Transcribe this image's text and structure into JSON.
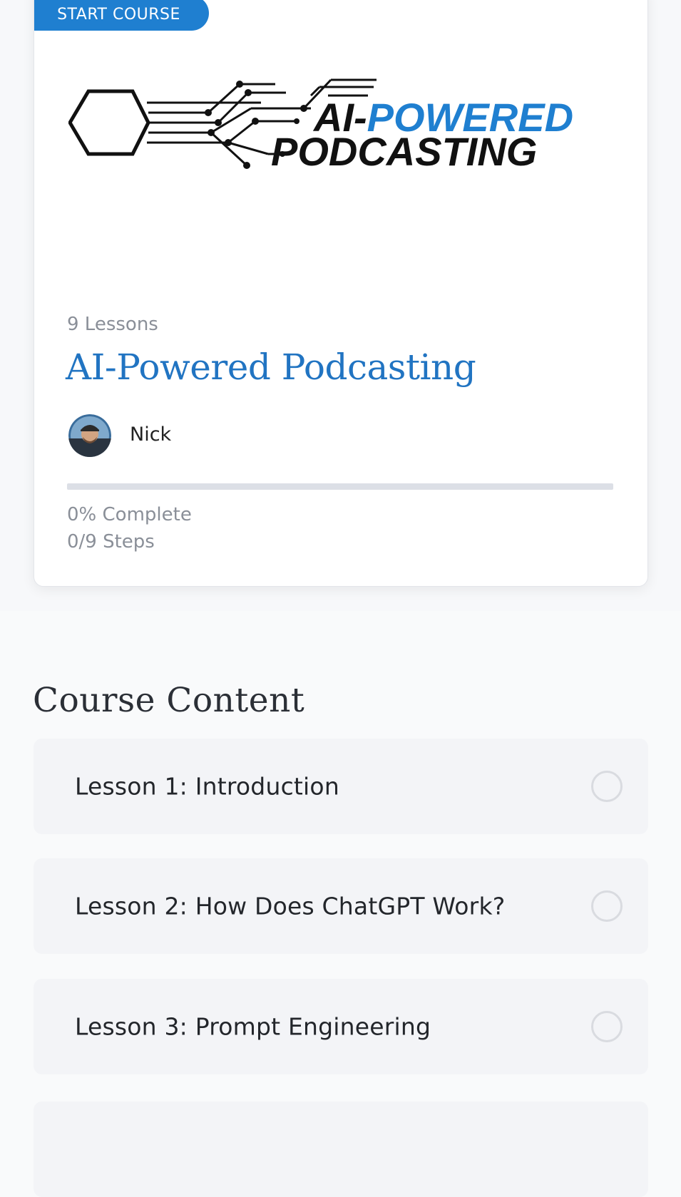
{
  "course": {
    "start_label": "START COURSE",
    "logo": {
      "line1": "AI-",
      "line1_accent": "POWERED",
      "line2": "PODCASTING",
      "colors": {
        "dark": "#111111",
        "accent": "#1f7fd0"
      }
    },
    "lesson_count": "9 Lessons",
    "title": "AI-Powered Podcasting",
    "author": "Nick",
    "progress": {
      "percent_value": 0,
      "percent_text": "0% Complete",
      "steps_text": "0/9 Steps"
    }
  },
  "content": {
    "heading": "Course Content",
    "lessons": [
      {
        "label": "Lesson 1: Introduction",
        "status_icon": "circle-outline-icon"
      },
      {
        "label": "Lesson 2: How Does ChatGPT Work?",
        "status_icon": "circle-outline-icon"
      },
      {
        "label": "Lesson 3: Prompt Engineering",
        "status_icon": "circle-outline-icon"
      }
    ]
  },
  "colors": {
    "brand_blue": "#2174c2",
    "button_blue": "#1f7fd0",
    "muted_text": "#8a8f98",
    "row_background": "#f3f4f7"
  }
}
